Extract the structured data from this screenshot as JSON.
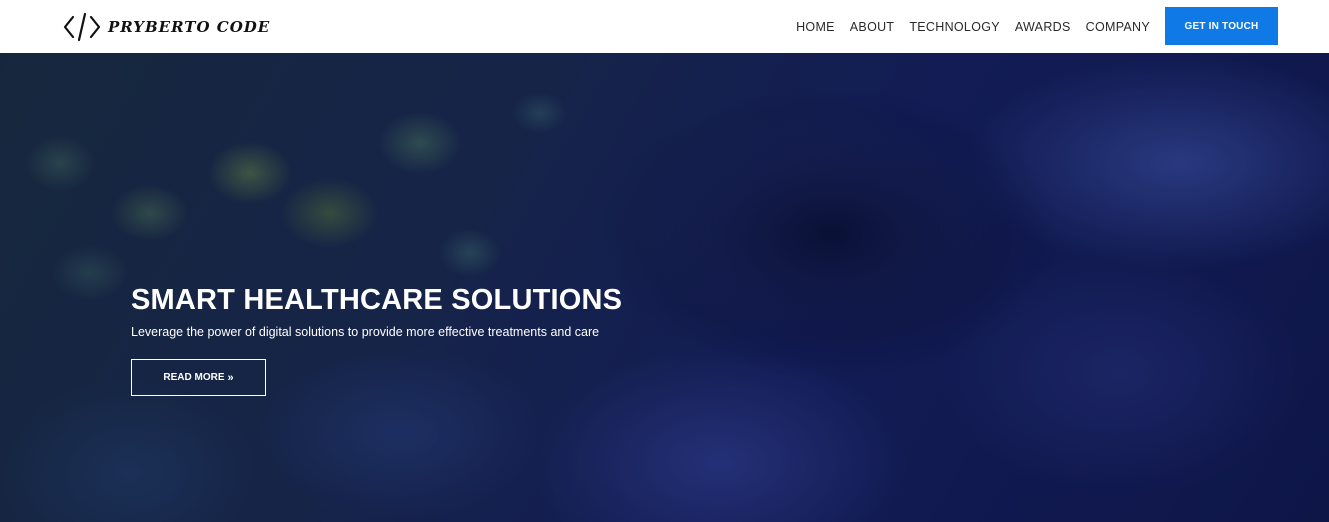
{
  "brand": {
    "name": "PRYBERTO CODE",
    "icon": "code-brackets-icon"
  },
  "nav": {
    "links": [
      {
        "label": "HOME"
      },
      {
        "label": "ABOUT"
      },
      {
        "label": "TECHNOLOGY"
      },
      {
        "label": "AWARDS"
      },
      {
        "label": "COMPANY"
      }
    ],
    "cta_label": "GET IN TOUCH"
  },
  "hero": {
    "title": "SMART HEALTHCARE SOLUTIONS",
    "subtitle": "Leverage the power of digital solutions to provide more effective treatments and care",
    "button_label": "READ MORE",
    "button_icon": "double-chevron-right-icon",
    "background_image": "blurred-blue-flower-petals"
  },
  "colors": {
    "accent": "#0f7ae5",
    "nav_bg": "#ffffff",
    "nav_text": "#2a2a2a",
    "hero_text": "#ffffff"
  }
}
